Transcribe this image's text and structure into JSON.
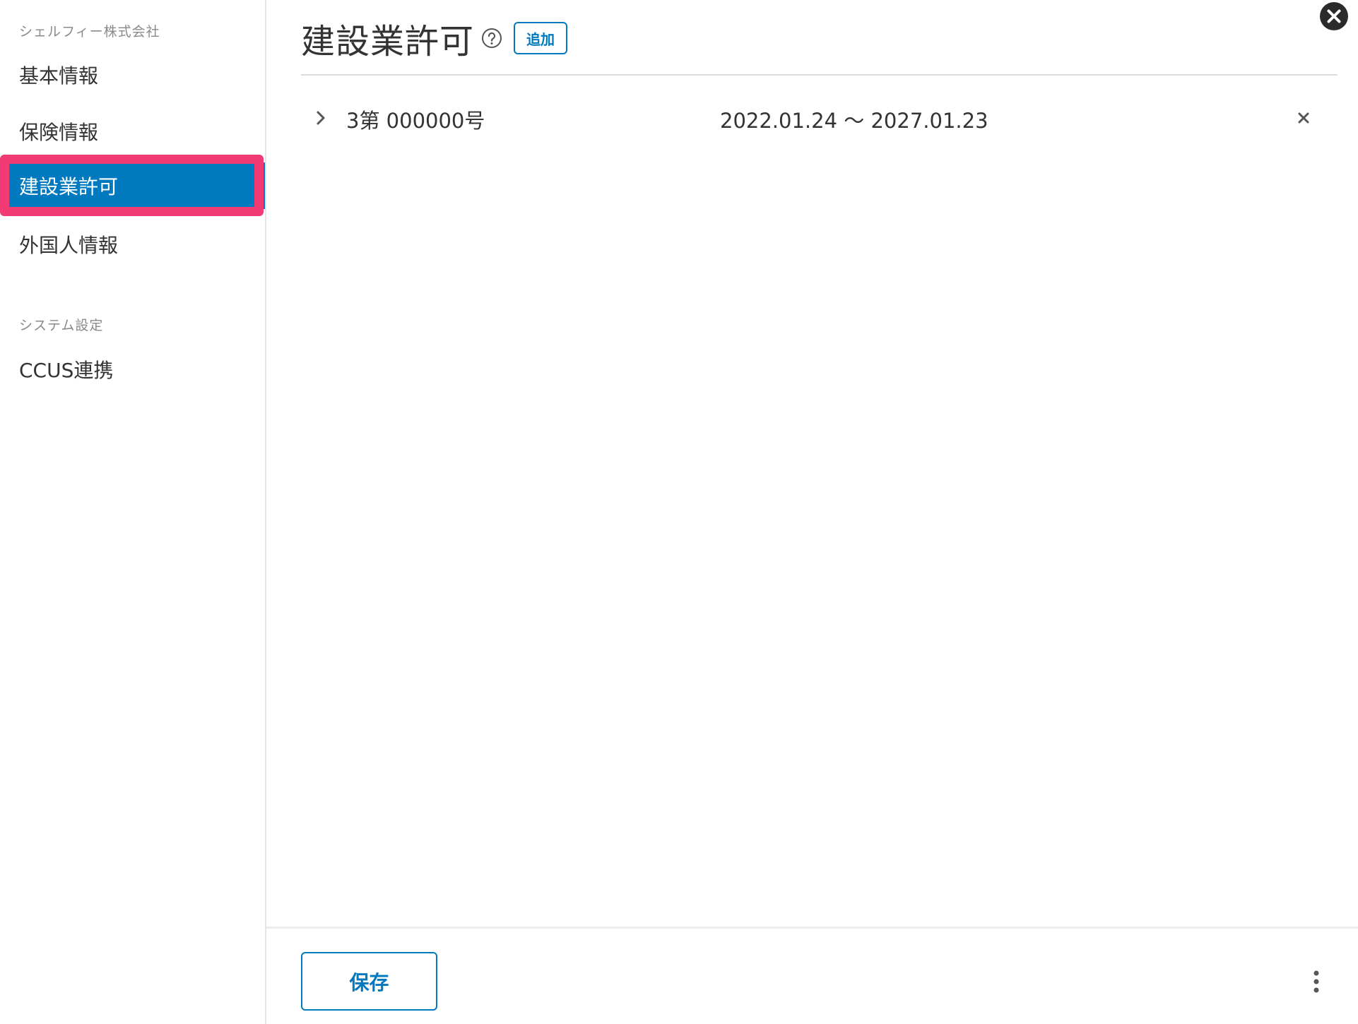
{
  "sidebar": {
    "company_section": "シェルフィー株式会社",
    "items": [
      {
        "label": "基本情報"
      },
      {
        "label": "保険情報"
      },
      {
        "label": "建設業許可"
      },
      {
        "label": "外国人情報"
      }
    ],
    "system_section": "システム設定",
    "system_items": [
      {
        "label": "CCUS連携"
      }
    ],
    "active_color": "#0079be",
    "highlight_color": "#f23a74"
  },
  "main": {
    "title": "建設業許可",
    "help_icon": "question-circle-icon",
    "add_label": "追加",
    "permits": [
      {
        "number": "3第 000000号",
        "period": "2022.01.24 ～ 2027.01.23"
      }
    ]
  },
  "footer": {
    "save_label": "保存",
    "more_icon": "vertical-ellipsis-icon"
  },
  "close_icon": "close-circle-icon",
  "accent_color": "#0079be"
}
